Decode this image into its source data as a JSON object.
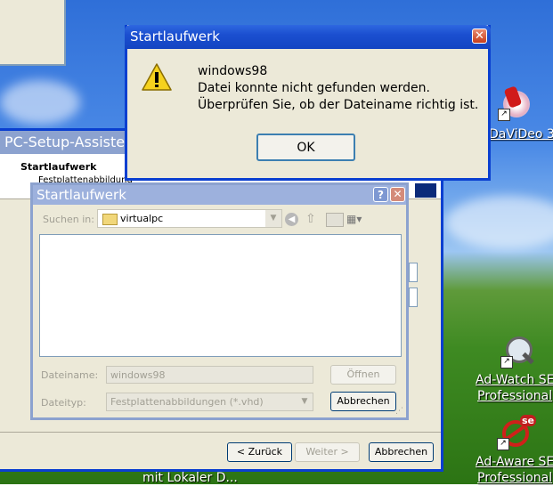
{
  "message_box": {
    "title": "Startlaufwerk",
    "close_label": "✕",
    "line1": "windows98",
    "line2": "Datei konnte nicht gefunden werden.",
    "line3": "Überprüfen Sie, ob der Dateiname richtig ist.",
    "ok_label": "OK"
  },
  "wizard": {
    "title": "PC-Setup-Assiste",
    "heading": "Startlaufwerk",
    "subheading": "Festplattenabbildung",
    "back_label": "< Zurück",
    "next_label": "Weiter >",
    "cancel_label": "Abbrechen"
  },
  "open_dialog": {
    "title": "Startlaufwerk",
    "help_label": "?",
    "close_label": "✕",
    "lookin_label": "Suchen in:",
    "lookin_value": "virtualpc",
    "filename_label": "Dateiname:",
    "filename_value": "windows98",
    "filetype_label": "Dateityp:",
    "filetype_value": "Festplattenabbildungen (*.vhd)",
    "open_label": "Öffnen",
    "cancel_label": "Abbrechen"
  },
  "desktop": {
    "icon1_label": "DaViDeo 3",
    "icon2_line1": "Ad-Watch SE",
    "icon2_line2": "Professional",
    "icon3_line1": "Ad-Aware SE",
    "icon3_line2": "Professional",
    "bottom_label": "mit Lokaler D..."
  }
}
